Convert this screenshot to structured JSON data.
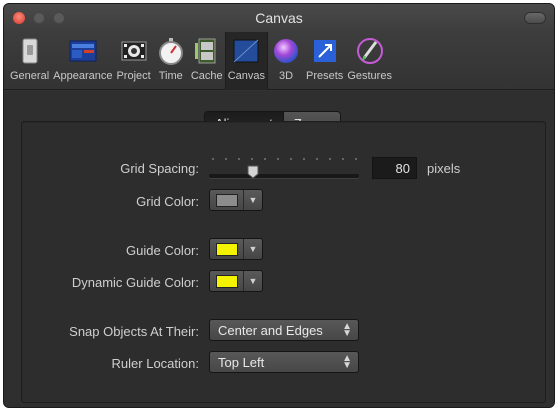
{
  "window": {
    "title": "Canvas"
  },
  "toolbar": {
    "items": [
      {
        "label": "General",
        "icon": "general-switch-icon"
      },
      {
        "label": "Appearance",
        "icon": "appearance-window-icon"
      },
      {
        "label": "Project",
        "icon": "project-film-icon"
      },
      {
        "label": "Time",
        "icon": "stopwatch-icon"
      },
      {
        "label": "Cache",
        "icon": "cache-film-icon"
      },
      {
        "label": "Canvas",
        "icon": "canvas-icon",
        "selected": true
      },
      {
        "label": "3D",
        "icon": "3d-sphere-icon"
      },
      {
        "label": "Presets",
        "icon": "presets-arrow-icon"
      },
      {
        "label": "Gestures",
        "icon": "gestures-pen-icon"
      }
    ]
  },
  "tabs": [
    {
      "label": "Alignment",
      "selected": true
    },
    {
      "label": "Zones",
      "selected": false
    }
  ],
  "alignment": {
    "grid_spacing": {
      "label": "Grid Spacing:",
      "value": "80",
      "unit": "pixels",
      "slider_fraction": 0.27
    },
    "grid_color": {
      "label": "Grid Color:",
      "color": "#8c8c8c"
    },
    "guide_color": {
      "label": "Guide Color:",
      "color": "#f5f200"
    },
    "dynamic_guide_color": {
      "label": "Dynamic Guide Color:",
      "color": "#f5f200"
    },
    "snap_objects": {
      "label": "Snap Objects At Their:",
      "value": "Center and Edges"
    },
    "ruler_location": {
      "label": "Ruler Location:",
      "value": "Top Left"
    }
  }
}
